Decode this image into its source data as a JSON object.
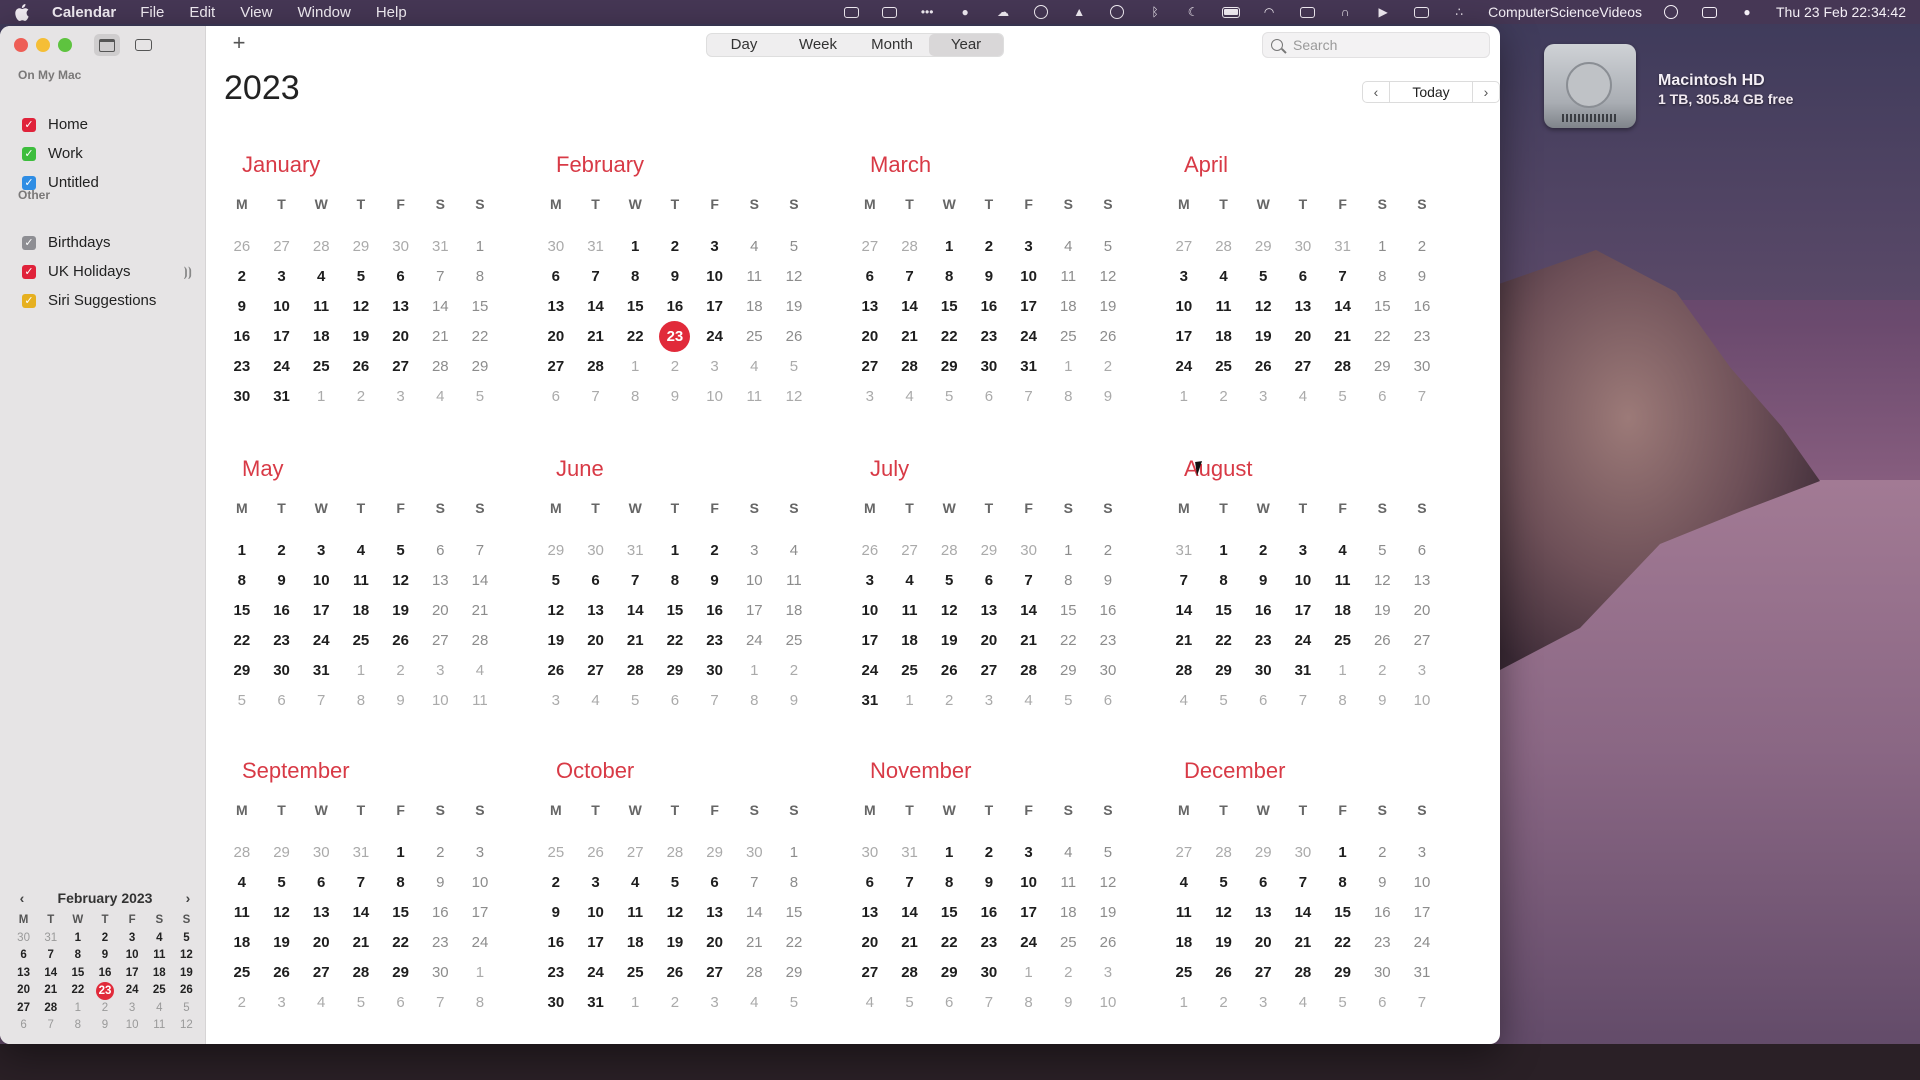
{
  "menubar": {
    "app_name": "Calendar",
    "menus": [
      "File",
      "Edit",
      "View",
      "Window",
      "Help"
    ],
    "user_name": "ComputerScienceVideos",
    "clock": "Thu 23 Feb  22:34:42"
  },
  "desktop": {
    "disk_name": "Macintosh HD",
    "disk_info": "1 TB, 305.84 GB free"
  },
  "sidebar": {
    "section_mac": "On My Mac",
    "section_other": "Other",
    "mac_calendars": [
      {
        "label": "Home",
        "color": "#e0223a"
      },
      {
        "label": "Work",
        "color": "#3dbd3d"
      },
      {
        "label": "Untitled",
        "color": "#2f8de4"
      }
    ],
    "other_calendars": [
      {
        "label": "Birthdays",
        "color": "#8e8e93"
      },
      {
        "label": "UK Holidays",
        "color": "#e0223a"
      },
      {
        "label": "Siri Suggestions",
        "color": "#e6b020"
      }
    ],
    "mini": {
      "title": "February 2023",
      "prev": "‹",
      "next": "›",
      "dow": [
        "M",
        "T",
        "W",
        "T",
        "F",
        "S",
        "S"
      ],
      "weeks": [
        [
          "30",
          "31",
          "1",
          "2",
          "3",
          "4",
          "5"
        ],
        [
          "6",
          "7",
          "8",
          "9",
          "10",
          "11",
          "12"
        ],
        [
          "13",
          "14",
          "15",
          "16",
          "17",
          "18",
          "19"
        ],
        [
          "20",
          "21",
          "22",
          "23",
          "24",
          "25",
          "26"
        ],
        [
          "27",
          "28",
          "1",
          "2",
          "3",
          "4",
          "5"
        ],
        [
          "6",
          "7",
          "8",
          "9",
          "10",
          "11",
          "12"
        ]
      ],
      "today": "23"
    }
  },
  "toolbar": {
    "add_label": "+",
    "views": [
      "Day",
      "Week",
      "Month",
      "Year"
    ],
    "active_view": "Year",
    "search_placeholder": "Search",
    "today_label": "Today",
    "prev_label": "‹",
    "next_label": "›"
  },
  "year": "2023",
  "dow": [
    "M",
    "T",
    "W",
    "T",
    "F",
    "S",
    "S"
  ],
  "months": [
    {
      "name": "January",
      "days": 31,
      "start": 6,
      "prev_days": 31
    },
    {
      "name": "February",
      "days": 28,
      "start": 2,
      "prev_days": 31,
      "today": 23
    },
    {
      "name": "March",
      "days": 31,
      "start": 2,
      "prev_days": 28
    },
    {
      "name": "April",
      "days": 30,
      "start": 5,
      "prev_days": 31
    },
    {
      "name": "May",
      "days": 31,
      "start": 0,
      "prev_days": 30
    },
    {
      "name": "June",
      "days": 30,
      "start": 3,
      "prev_days": 31
    },
    {
      "name": "July",
      "days": 31,
      "start": 5,
      "prev_days": 30
    },
    {
      "name": "August",
      "days": 31,
      "start": 1,
      "prev_days": 31
    },
    {
      "name": "September",
      "days": 30,
      "start": 4,
      "prev_days": 31
    },
    {
      "name": "October",
      "days": 31,
      "start": 6,
      "prev_days": 30
    },
    {
      "name": "November",
      "days": 30,
      "start": 2,
      "prev_days": 31
    },
    {
      "name": "December",
      "days": 31,
      "start": 4,
      "prev_days": 30
    }
  ]
}
